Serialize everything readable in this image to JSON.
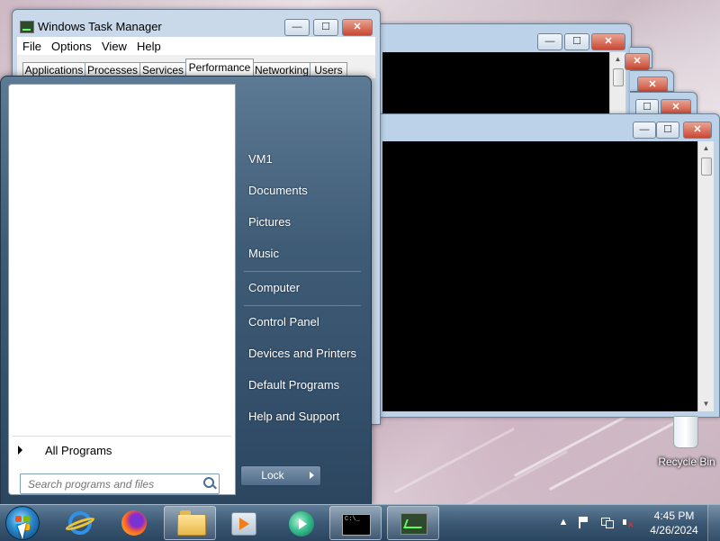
{
  "taskmgr": {
    "title": "Windows Task Manager",
    "menu": [
      "File",
      "Options",
      "View",
      "Help"
    ],
    "tabs": [
      "Applications",
      "Processes",
      "Services",
      "Performance",
      "Networking",
      "Users"
    ],
    "active_tab": "Performance"
  },
  "startmenu": {
    "all_programs": "All Programs",
    "search_placeholder": "Search programs and files",
    "right_items": [
      "VM1",
      "Documents",
      "Pictures",
      "Music",
      "Computer",
      "Control Panel",
      "Devices and Printers",
      "Default Programs",
      "Help and Support"
    ],
    "lock_label": "Lock"
  },
  "desktop": {
    "recycle_bin": "Recycle Bin"
  },
  "taskbar": {
    "time": "4:45 PM",
    "date": "4/26/2024"
  },
  "icons": {
    "start": "windows-start-orb-icon",
    "ie": "internet-explorer-icon",
    "firefox": "firefox-icon",
    "explorer": "windows-explorer-folder-icon",
    "media_center": "windows-media-center-icon",
    "media_player": "windows-media-player-icon",
    "cmd": "command-prompt-icon",
    "taskmgr": "task-manager-icon"
  }
}
